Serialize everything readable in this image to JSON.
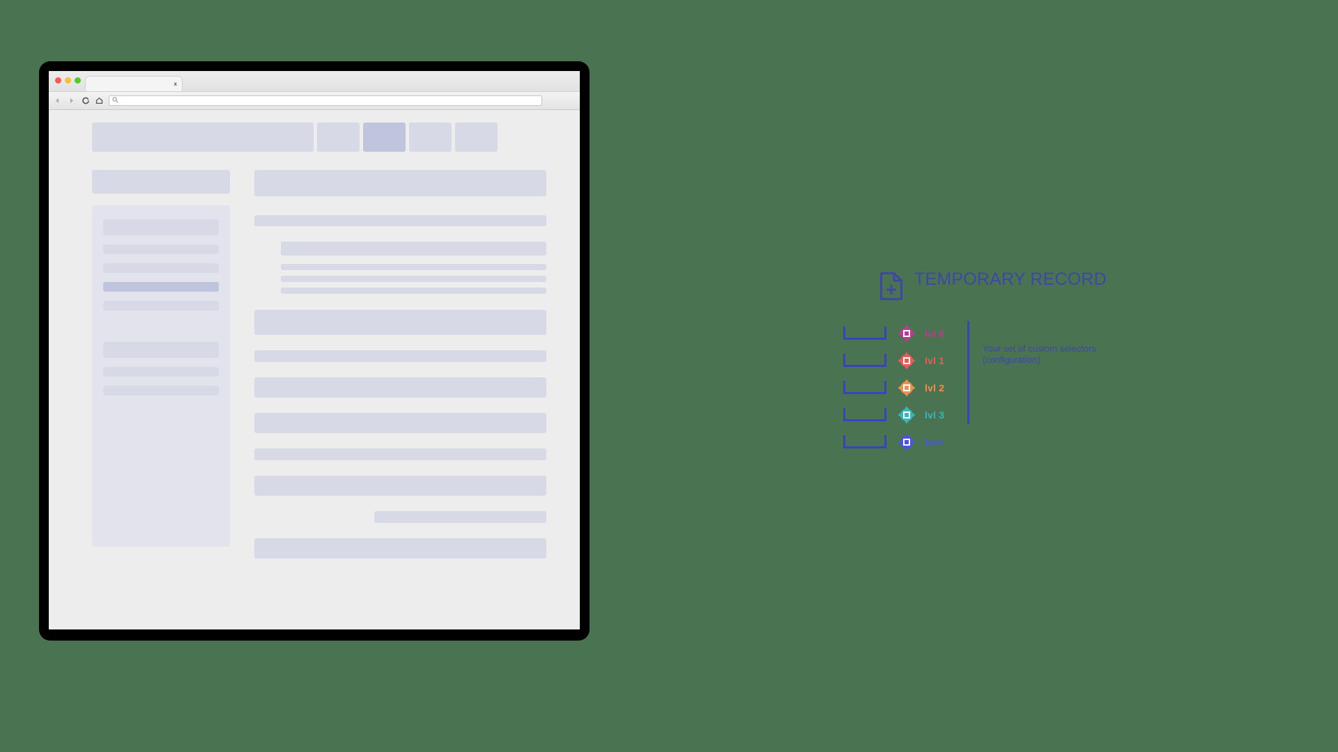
{
  "background_color": "#4a7352",
  "browser": {
    "traffic_lights": [
      {
        "name": "close",
        "color": "#f45b52"
      },
      {
        "name": "minimize",
        "color": "#f6bd3f"
      },
      {
        "name": "maximize",
        "color": "#53c92f"
      }
    ],
    "tab": {
      "title": "",
      "close_label": "x"
    },
    "toolbar": {
      "back_icon": "back-arrow-icon",
      "forward_icon": "forward-arrow-icon",
      "reload_icon": "reload-icon",
      "home_icon": "home-icon",
      "address_placeholder": "",
      "address_value": "",
      "search_icon": "search-icon"
    }
  },
  "skeleton": {
    "nav": {
      "brand_width": 318,
      "items": [
        {
          "id": "nav-item-1",
          "active": false
        },
        {
          "id": "nav-item-2",
          "active": true
        },
        {
          "id": "nav-item-3",
          "active": false
        },
        {
          "id": "nav-item-4",
          "active": false
        }
      ]
    },
    "colors": {
      "page": "#ededed",
      "placeholder": "#d8d9e6",
      "placeholder_active": "#c0c5de",
      "panel": "#e2e3ec"
    },
    "sidebar": {
      "group_a": [
        "tall",
        "thin",
        "thin",
        "thin-active",
        "thin"
      ],
      "group_b": [
        "tall",
        "thin",
        "thin"
      ]
    },
    "content_rows": [
      "hero",
      "bar",
      "indent-group",
      "block-lg",
      "block-sm",
      "block-md",
      "block-md",
      "block-sm",
      "block-md",
      "block-offset",
      "block-md"
    ]
  },
  "annotation": {
    "title": "TEMPORARY RECORD",
    "title_color": "#3f46a8",
    "doc_icon": "document-plus-icon",
    "accent_color": "#3a43bd",
    "note": "Your set of custom selectors (configuration)",
    "selectors": [
      {
        "label": "lvl 0",
        "color": "#b83d8c",
        "icon": "target-square-icon"
      },
      {
        "label": "lvl 1",
        "color": "#ec5b56",
        "icon": "target-square-icon"
      },
      {
        "label": "lvl 2",
        "color": "#f0904d",
        "icon": "target-square-icon"
      },
      {
        "label": "lvl 3",
        "color": "#35b8bd",
        "icon": "target-square-icon"
      },
      {
        "label": "text",
        "color": "#4a54e0",
        "icon": "target-square-icon"
      }
    ]
  }
}
